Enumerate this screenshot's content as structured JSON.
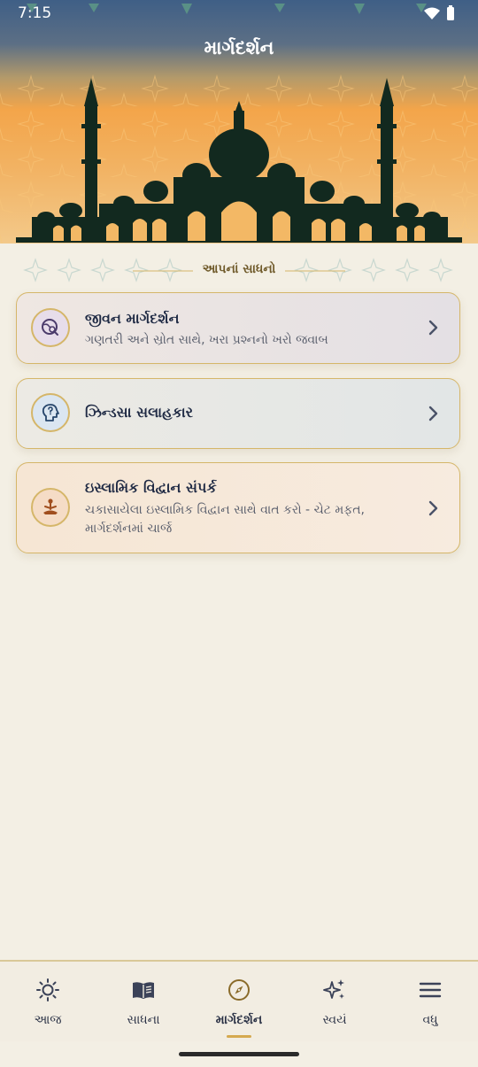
{
  "status_bar": {
    "time": "7:15"
  },
  "header": {
    "title": "માર્ગદર્શન"
  },
  "section": {
    "title": "આપનાં સાધનો"
  },
  "cards": [
    {
      "title": "જીવન માર્ગદર્શન",
      "subtitle": "ગણતરી અને સ્રોત સાથે, ખરા પ્રશ્નનો ખરો જવાબ",
      "icon": "globe-search-icon"
    },
    {
      "title": "ઝિન્ડસા સલાહકાર",
      "subtitle": "",
      "icon": "head-question-icon"
    },
    {
      "title": "ઇસ્લામિક વિદ્વાન સંપર્ક",
      "subtitle": "ચકાસાયેલા ઇસ્લામિક વિદ્વાન સાથે વાત કરો - ચેટ મફત, માર્ગદર્શનમાં ચાર્જ",
      "icon": "meditation-icon"
    }
  ],
  "bottom_nav": [
    {
      "label": "આજ",
      "icon": "sun-icon"
    },
    {
      "label": "સાધના",
      "icon": "book-icon"
    },
    {
      "label": "માર્ગદર્શન",
      "icon": "compass-icon",
      "active": true
    },
    {
      "label": "સ્વયં",
      "icon": "sparkle-icon"
    },
    {
      "label": "વધુ",
      "icon": "menu-icon"
    }
  ],
  "colors": {
    "accent_gold": "#d5b669",
    "navy": "#1f2a44",
    "background": "#f3efe4"
  }
}
